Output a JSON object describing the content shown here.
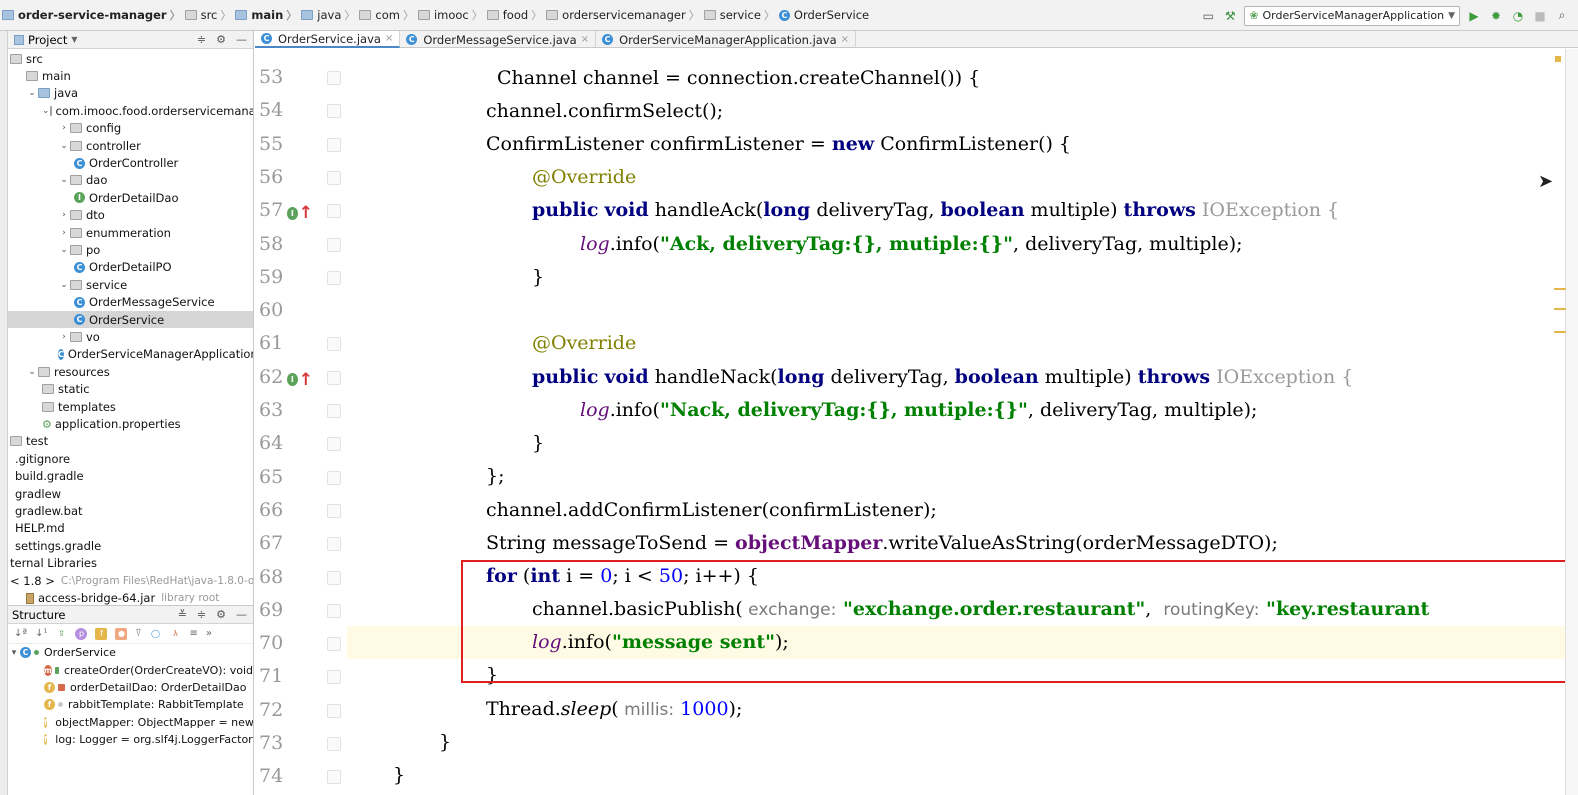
{
  "breadcrumbs": [
    {
      "label": "order-service-manager",
      "bold": true
    },
    {
      "label": "src"
    },
    {
      "label": "main",
      "bold": true
    },
    {
      "label": "java"
    },
    {
      "label": "com"
    },
    {
      "label": "imooc"
    },
    {
      "label": "food"
    },
    {
      "label": "orderservicemanager"
    },
    {
      "label": "service"
    },
    {
      "label": "OrderService"
    }
  ],
  "run_config": {
    "label": "OrderServiceManagerApplication"
  },
  "project_panel": {
    "title": "Project",
    "rows": [
      {
        "label": "src",
        "indent": 0,
        "icon": "folder",
        "arrow": ""
      },
      {
        "label": "main",
        "indent": 1,
        "icon": "folder",
        "arrow": ""
      },
      {
        "label": "java",
        "indent": 1,
        "icon": "folder-blue",
        "arrow": "down"
      },
      {
        "label": "com.imooc.food.orderservicemanager",
        "indent": 2,
        "icon": "package",
        "arrow": "down"
      },
      {
        "label": "config",
        "indent": 3,
        "icon": "package",
        "arrow": "right"
      },
      {
        "label": "controller",
        "indent": 3,
        "icon": "package",
        "arrow": "down"
      },
      {
        "label": "OrderController",
        "indent": 4,
        "icon": "class",
        "arrow": ""
      },
      {
        "label": "dao",
        "indent": 3,
        "icon": "package",
        "arrow": "down"
      },
      {
        "label": "OrderDetailDao",
        "indent": 4,
        "icon": "interface",
        "arrow": ""
      },
      {
        "label": "dto",
        "indent": 3,
        "icon": "package",
        "arrow": "right"
      },
      {
        "label": "enummeration",
        "indent": 3,
        "icon": "package",
        "arrow": "right"
      },
      {
        "label": "po",
        "indent": 3,
        "icon": "package",
        "arrow": "down"
      },
      {
        "label": "OrderDetailPO",
        "indent": 4,
        "icon": "class",
        "arrow": ""
      },
      {
        "label": "service",
        "indent": 3,
        "icon": "package",
        "arrow": "down"
      },
      {
        "label": "OrderMessageService",
        "indent": 4,
        "icon": "class",
        "arrow": ""
      },
      {
        "label": "OrderService",
        "indent": 4,
        "icon": "class",
        "arrow": "",
        "selected": true
      },
      {
        "label": "vo",
        "indent": 3,
        "icon": "package",
        "arrow": "right"
      },
      {
        "label": "OrderServiceManagerApplication",
        "indent": 3,
        "icon": "spring-class",
        "arrow": ""
      },
      {
        "label": "resources",
        "indent": 1,
        "icon": "folder",
        "arrow": "down"
      },
      {
        "label": "static",
        "indent": 2,
        "icon": "folder",
        "arrow": ""
      },
      {
        "label": "templates",
        "indent": 2,
        "icon": "folder",
        "arrow": ""
      },
      {
        "label": "application.properties",
        "indent": 2,
        "icon": "properties",
        "arrow": ""
      },
      {
        "label": "test",
        "indent": 0,
        "icon": "folder",
        "arrow": ""
      },
      {
        "label": ".gitignore",
        "indent": 0,
        "icon": "file",
        "arrow": ""
      },
      {
        "label": "build.gradle",
        "indent": 0,
        "icon": "file",
        "arrow": ""
      },
      {
        "label": "gradlew",
        "indent": 0,
        "icon": "file",
        "arrow": ""
      },
      {
        "label": "gradlew.bat",
        "indent": 0,
        "icon": "file",
        "arrow": ""
      },
      {
        "label": "HELP.md",
        "indent": 0,
        "icon": "file",
        "arrow": ""
      },
      {
        "label": "settings.gradle",
        "indent": 0,
        "icon": "file",
        "arrow": ""
      },
      {
        "label": "ternal Libraries",
        "indent": 0,
        "icon": "none",
        "arrow": ""
      },
      {
        "label": "< 1.8 >",
        "indent": 0,
        "icon": "none",
        "arrow": "",
        "hint": "C:\\Program Files\\RedHat\\java-1.8.0-openj"
      },
      {
        "label": "access-bridge-64.jar",
        "indent": 1,
        "icon": "jar",
        "arrow": "",
        "hint": "library root"
      }
    ]
  },
  "structure_panel": {
    "title": "Structure",
    "root": "OrderService",
    "members": [
      {
        "label": "createOrder(OrderCreateVO): void",
        "kind": "m",
        "access": "public"
      },
      {
        "label": "orderDetailDao: OrderDetailDao",
        "kind": "f",
        "access": "private"
      },
      {
        "label": "rabbitTemplate: RabbitTemplate",
        "kind": "f",
        "access": "package"
      },
      {
        "label": "objectMapper: ObjectMapper = new O",
        "kind": "f",
        "access": "package"
      },
      {
        "label": "log: Logger = org.slf4j.LoggerFactory.",
        "kind": "f",
        "access": "private"
      }
    ]
  },
  "tabs": [
    {
      "label": "OrderService.java",
      "active": true
    },
    {
      "label": "OrderMessageService.java",
      "active": false
    },
    {
      "label": "OrderServiceManagerApplication.java",
      "active": false
    }
  ],
  "editor": {
    "line_numbers": [
      "53",
      "54",
      "55",
      "56",
      "57",
      "58",
      "59",
      "60",
      "61",
      "62",
      "63",
      "64",
      "65",
      "66",
      "67",
      "68",
      "69",
      "70",
      "71",
      "72",
      "73",
      "74"
    ],
    "code": {
      "l53": "Channel channel = connection.createChannel()) {",
      "l54": "channel.confirmSelect();",
      "l55a": "ConfirmListener confirmListener = ",
      "l55b": "new",
      "l55c": " ConfirmListener() {",
      "l56": "@Override",
      "l57a": "public",
      "l57b": " ",
      "l57c": "void",
      "l57d": " handleAck(",
      "l57e": "long",
      "l57f": " deliveryTag, ",
      "l57g": "boolean",
      "l57h": " multiple) ",
      "l57i": "throws",
      "l57j": " IOException {",
      "l58a": "log",
      "l58b": ".info(",
      "l58c": "\"Ack, deliveryTag:{}, mutiple:{}\"",
      "l58d": ", deliveryTag, multiple);",
      "l59": "}",
      "l61": "@Override",
      "l62a": "public",
      "l62c": "void",
      "l62d": " handleNack(",
      "l62e": "long",
      "l62f": " deliveryTag, ",
      "l62g": "boolean",
      "l62h": " multiple) ",
      "l62i": "throws",
      "l62j": " IOException {",
      "l63a": "log",
      "l63b": ".info(",
      "l63c": "\"Nack, deliveryTag:{}, mutiple:{}\"",
      "l63d": ", deliveryTag, multiple);",
      "l64": "}",
      "l65": "};",
      "l66": "channel.addConfirmListener(confirmListener);",
      "l67a": "String messageToSend = ",
      "l67b": "objectMapper",
      "l67c": ".writeValueAsString(orderMessageDTO);",
      "l68a": "for",
      "l68b": " (",
      "l68c": "int",
      "l68d": " i = ",
      "l68e": "0",
      "l68f": "; i < ",
      "l68g": "50",
      "l68h": "; i++) {",
      "l69a": "channel.basicPublish(",
      "l69b": " exchange:",
      "l69c": " \"exchange.order.restaurant\"",
      "l69d": ",  ",
      "l69e": "routingKey:",
      "l69f": " \"key.restaurant",
      "l70a": "log",
      "l70b": ".info(",
      "l70c": "\"message sent\"",
      "l70d": ");",
      "l71": "}",
      "l72a": "Thread.",
      "l72b": "sleep",
      "l72c": "(",
      "l72d": " millis:",
      "l72e": " 1000",
      "l72f": ");",
      "l73": "}",
      "l74": "}"
    }
  },
  "colors": {
    "keyword": "#000080",
    "string": "#008000",
    "annotation": "#808000",
    "number": "#0000ff",
    "field": "#660e7a",
    "highlight_box": "#e02020"
  }
}
